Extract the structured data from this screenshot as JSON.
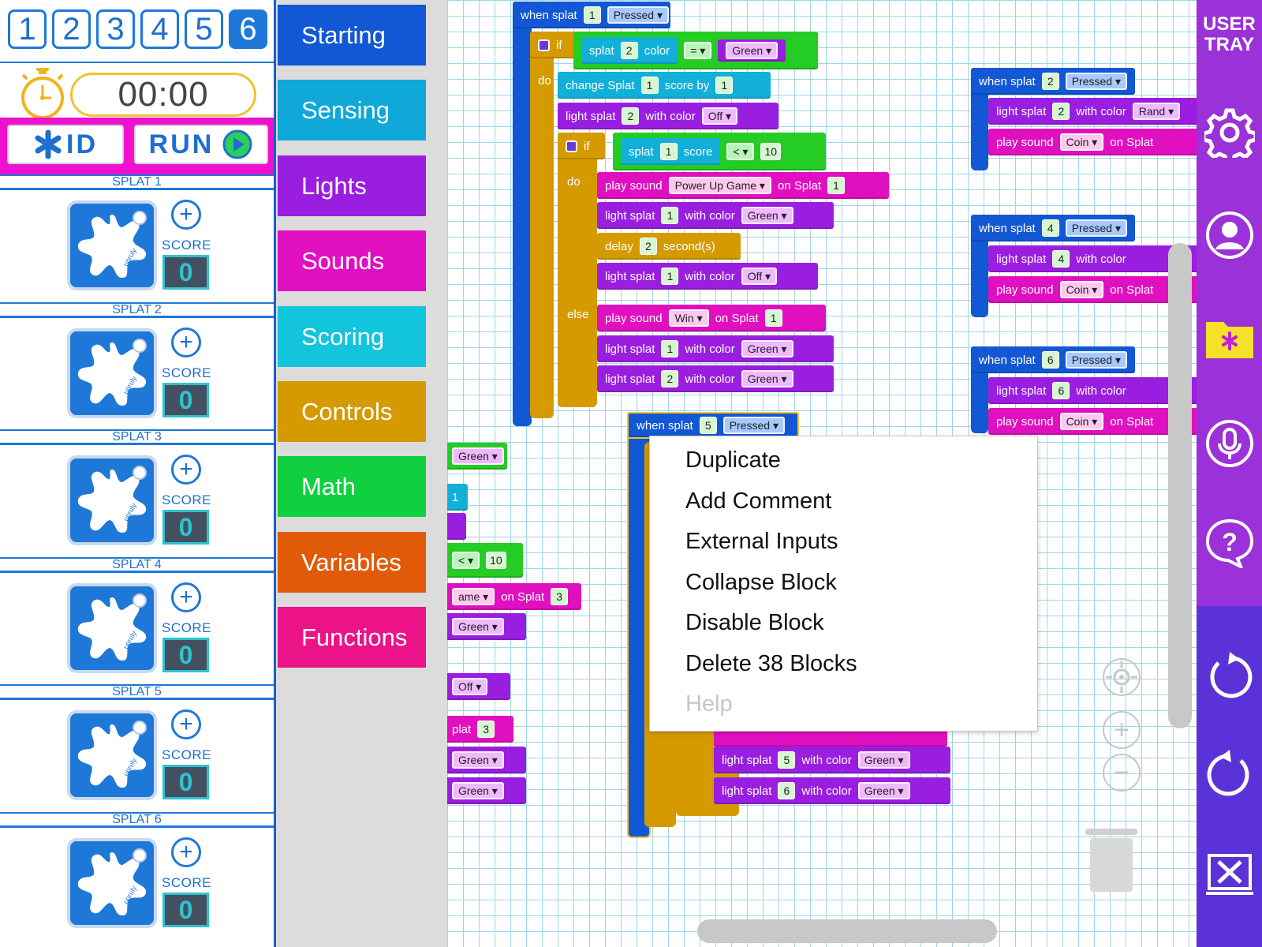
{
  "tabs": [
    "1",
    "2",
    "3",
    "4",
    "5",
    "6"
  ],
  "active_tab": "6",
  "timer": {
    "value": "00:00"
  },
  "buttons": {
    "id_label": "ID",
    "run_label": "RUN"
  },
  "splats": [
    {
      "name": "SPLAT 1",
      "score_label": "SCORE",
      "score": "0",
      "logo": "unruly"
    },
    {
      "name": "SPLAT 2",
      "score_label": "SCORE",
      "score": "0",
      "logo": "unruly"
    },
    {
      "name": "SPLAT 3",
      "score_label": "SCORE",
      "score": "0",
      "logo": "unruly"
    },
    {
      "name": "SPLAT 4",
      "score_label": "SCORE",
      "score": "0",
      "logo": "unruly"
    },
    {
      "name": "SPLAT 5",
      "score_label": "SCORE",
      "score": "0",
      "logo": "unruly"
    },
    {
      "name": "SPLAT 6",
      "score_label": "SCORE",
      "score": "0",
      "logo": "unruly"
    }
  ],
  "categories": [
    {
      "label": "Starting",
      "color": "#1257d4"
    },
    {
      "label": "Sensing",
      "color": "#0fa8d8"
    },
    {
      "label": "Lights",
      "color": "#9a1ee0"
    },
    {
      "label": "Sounds",
      "color": "#e010c0"
    },
    {
      "label": "Scoring",
      "color": "#12c4dc"
    },
    {
      "label": "Controls",
      "color": "#d49a00"
    },
    {
      "label": "Math",
      "color": "#10d040"
    },
    {
      "label": "Variables",
      "color": "#e05a08"
    },
    {
      "label": "Functions",
      "color": "#ec1288"
    }
  ],
  "blocks": {
    "when_splat": "when splat",
    "pressed": "Pressed",
    "if": "if",
    "do": "do",
    "else": "else",
    "splat": "splat",
    "color": "color",
    "eq": "=",
    "lt": "<",
    "green": "Green",
    "off": "Off",
    "change_splat": "change Splat",
    "score_by": "score by",
    "light_splat": "light splat",
    "with_color": "with color",
    "score": "score",
    "play_sound": "play sound",
    "power_up_game": "Power Up Game",
    "on_splat": "on Splat",
    "delay": "delay",
    "seconds": "second(s)",
    "win": "Win",
    "coin": "Coin",
    "rand": "Rand",
    "n1": "1",
    "n2": "2",
    "n3": "3",
    "n4": "4",
    "n5": "5",
    "n6": "6",
    "n10": "10",
    "frag_green": "Green",
    "frag_lt": "<",
    "frag_10": "10",
    "frag_ame": "ame",
    "frag_on_splat": "on Splat",
    "frag_3": "3",
    "frag_off": "Off",
    "frag_plat": "plat",
    "frag_1": "1"
  },
  "context_menu": {
    "items": [
      {
        "label": "Duplicate",
        "enabled": true
      },
      {
        "label": "Add Comment",
        "enabled": true
      },
      {
        "label": "External Inputs",
        "enabled": true
      },
      {
        "label": "Collapse Block",
        "enabled": true
      },
      {
        "label": "Disable Block",
        "enabled": true
      },
      {
        "label": "Delete 38 Blocks",
        "enabled": true
      },
      {
        "label": "Help",
        "enabled": false
      }
    ]
  },
  "tray": {
    "title_line1": "USER",
    "title_line2": "TRAY",
    "icons": [
      "gear-icon",
      "user-icon",
      "folder-icon",
      "microphone-icon",
      "help-icon",
      "undo-icon",
      "redo-icon",
      "close-icon"
    ]
  }
}
